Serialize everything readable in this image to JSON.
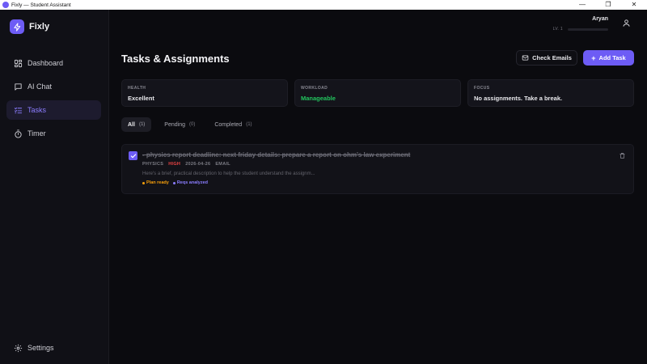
{
  "window": {
    "title": "Fixly — Student Assistant",
    "controls": {
      "minimize": "—",
      "restore": "❐",
      "close": "✕"
    }
  },
  "sidebar": {
    "brand": "Fixly",
    "items": [
      {
        "label": "Dashboard",
        "icon": "grid-icon",
        "active": false
      },
      {
        "label": "AI Chat",
        "icon": "chat-icon",
        "active": false
      },
      {
        "label": "Tasks",
        "icon": "tasks-icon",
        "active": true
      },
      {
        "label": "Timer",
        "icon": "timer-icon",
        "active": false
      }
    ],
    "settings_label": "Settings"
  },
  "user": {
    "name": "Aryan",
    "level_label": "LV. 1",
    "xp_progress": 0.0
  },
  "page": {
    "title": "Tasks & Assignments",
    "check_emails_label": "Check Emails",
    "add_task_label": "Add Task"
  },
  "stats": [
    {
      "label": "HEALTH",
      "value": "Excellent"
    },
    {
      "label": "WORKLOAD",
      "value": "Manageable"
    },
    {
      "label": "FOCUS",
      "value": "No assignments. Take a break."
    }
  ],
  "tabs": [
    {
      "label": "All",
      "count": "(1)",
      "active": true
    },
    {
      "label": "Pending",
      "count": "(0)",
      "active": false
    },
    {
      "label": "Completed",
      "count": "(1)",
      "active": false
    }
  ],
  "tasks": [
    {
      "title": "- physics report deadline: next friday details: prepare a report on ohm's law experiment",
      "completed": true,
      "subject": "PHYSICS",
      "priority": "HIGH",
      "date": "2026-04-26",
      "source": "EMAIL",
      "description": "Here's a brief, practical description to help the student understand the assignm...",
      "badges": [
        "Plan ready",
        "Reqs analyzed"
      ]
    }
  ],
  "colors": {
    "accent": "#6d5cf5",
    "workload_good": "#22c55e",
    "priority_high": "#ef4444",
    "badge_plan": "#f59e0b",
    "badge_reqs": "#8b7dff"
  }
}
